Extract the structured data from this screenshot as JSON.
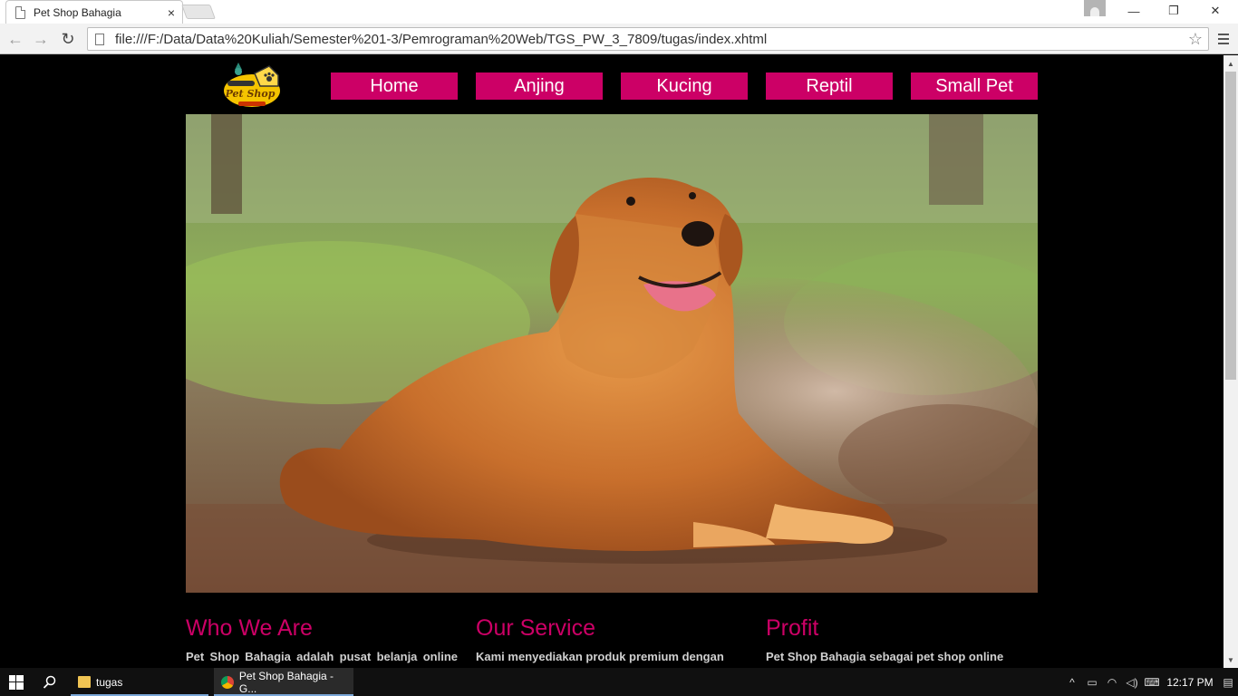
{
  "browser": {
    "tab_title": "Pet Shop Bahagia",
    "tab_close": "×",
    "url": "file:///F:/Data/Data%20Kuliah/Semester%201-3/Pemrograman%20Web/TGS_PW_3_7809/tugas/index.xhtml",
    "back_icon": "←",
    "forward_icon": "→",
    "reload_icon": "↻",
    "star_icon": "☆",
    "minimize_icon": "—",
    "restore_icon": "❐",
    "close_icon": "✕"
  },
  "site": {
    "logo_text": "Pet Shop",
    "menu": [
      {
        "label": "Home"
      },
      {
        "label": "Anjing"
      },
      {
        "label": "Kucing"
      },
      {
        "label": "Reptil"
      },
      {
        "label": "Small Pet"
      }
    ],
    "columns": [
      {
        "title": "Who We Are",
        "text": "Pet Shop Bahagia adalah pusat belanja online yang"
      },
      {
        "title": "Our Service",
        "text": "Kami menyediakan produk premium dengan"
      },
      {
        "title": "Profit",
        "text": "Pet Shop Bahagia sebagai pet shop online"
      }
    ],
    "accent_color": "#cc0066",
    "background_color": "#000000"
  },
  "taskbar": {
    "apps": [
      {
        "label": "tugas",
        "icon": "folder-icon"
      },
      {
        "label": "Pet Shop Bahagia - G...",
        "icon": "chrome-icon"
      }
    ],
    "clock": "12:17 PM"
  }
}
